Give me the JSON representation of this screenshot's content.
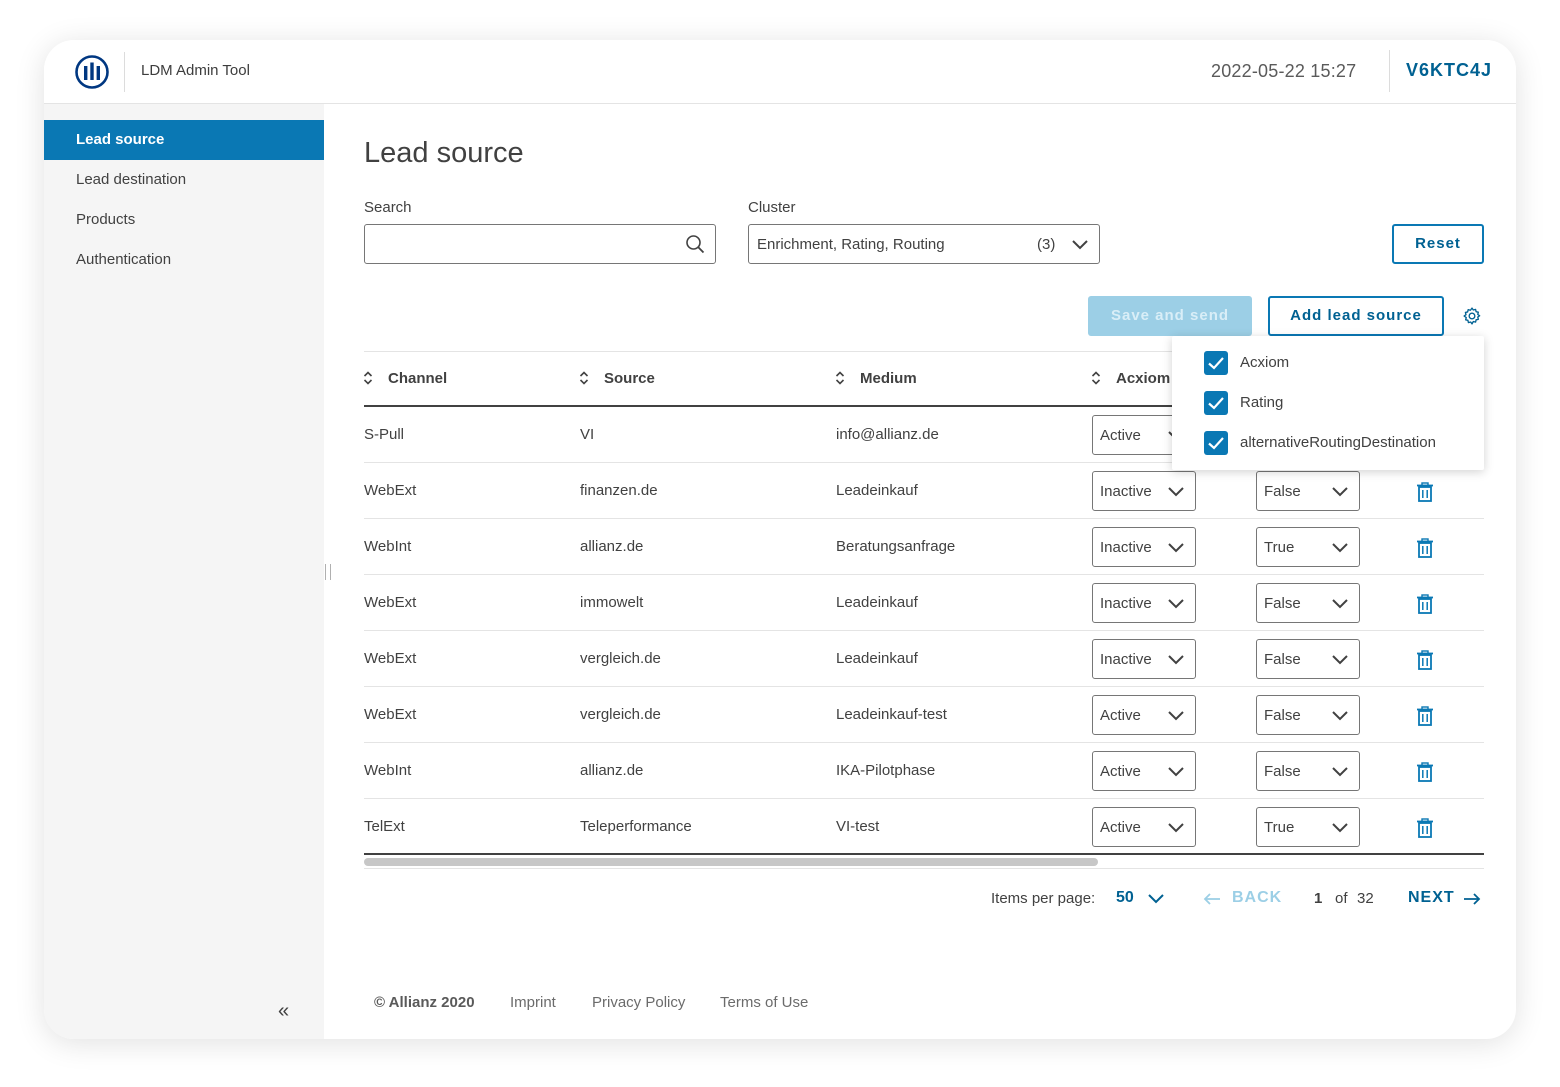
{
  "header": {
    "app_title": "LDM Admin Tool",
    "datetime": "2022-05-22 15:27",
    "user_id": "V6KTC4J"
  },
  "sidebar": {
    "items": [
      {
        "label": "Lead source",
        "active": true
      },
      {
        "label": "Lead destination",
        "active": false
      },
      {
        "label": "Products",
        "active": false
      },
      {
        "label": "Authentication",
        "active": false
      }
    ],
    "collapse_glyph": "«"
  },
  "main": {
    "title": "Lead source",
    "search": {
      "label": "Search",
      "value": "",
      "placeholder": ""
    },
    "cluster": {
      "label": "Cluster",
      "value": "Enrichment, Rating, Routing",
      "count": "(3)"
    },
    "reset_label": "Reset",
    "save_label": "Save and send",
    "add_label": "Add lead source"
  },
  "column_menu": {
    "options": [
      {
        "label": "Acxiom",
        "checked": true
      },
      {
        "label": "Rating",
        "checked": true
      },
      {
        "label": "alternativeRoutingDestination",
        "checked": true
      }
    ]
  },
  "table": {
    "columns": [
      "Channel",
      "Source",
      "Medium",
      "Acxiom"
    ],
    "rows": [
      {
        "channel": "S-Pull",
        "source": "VI",
        "medium": "info@allianz.de",
        "acxiom": "Active",
        "routing": ""
      },
      {
        "channel": "WebExt",
        "source": "finanzen.de",
        "medium": "Leadeinkauf",
        "acxiom": "Inactive",
        "routing": "False"
      },
      {
        "channel": "WebInt",
        "source": "allianz.de",
        "medium": "Beratungsanfrage",
        "acxiom": "Inactive",
        "routing": "True"
      },
      {
        "channel": "WebExt",
        "source": "immowelt",
        "medium": "Leadeinkauf",
        "acxiom": "Inactive",
        "routing": "False"
      },
      {
        "channel": "WebExt",
        "source": "vergleich.de",
        "medium": "Leadeinkauf",
        "acxiom": "Inactive",
        "routing": "False"
      },
      {
        "channel": "WebExt",
        "source": "vergleich.de",
        "medium": "Leadeinkauf-test",
        "acxiom": "Active",
        "routing": "False"
      },
      {
        "channel": "WebInt",
        "source": "allianz.de",
        "medium": "IKA-Pilotphase",
        "acxiom": "Active",
        "routing": "False"
      },
      {
        "channel": "TelExt",
        "source": "Teleperformance",
        "medium": "VI-test",
        "acxiom": "Active",
        "routing": "True"
      }
    ]
  },
  "pagination": {
    "items_per_page_label": "Items per page:",
    "items_per_page": "50",
    "back_label": "BACK",
    "current_page": "1",
    "of_label": "of",
    "total_pages": "32",
    "next_label": "NEXT"
  },
  "footer": {
    "copyright": "© Allianz 2020",
    "links": [
      "Imprint",
      "Privacy Policy",
      "Terms of Use"
    ]
  },
  "colors": {
    "primary": "#0a78b4",
    "primary_dark": "#006192",
    "disabled": "#9ccfe6",
    "sidebar_bg": "#f5f5f5"
  }
}
